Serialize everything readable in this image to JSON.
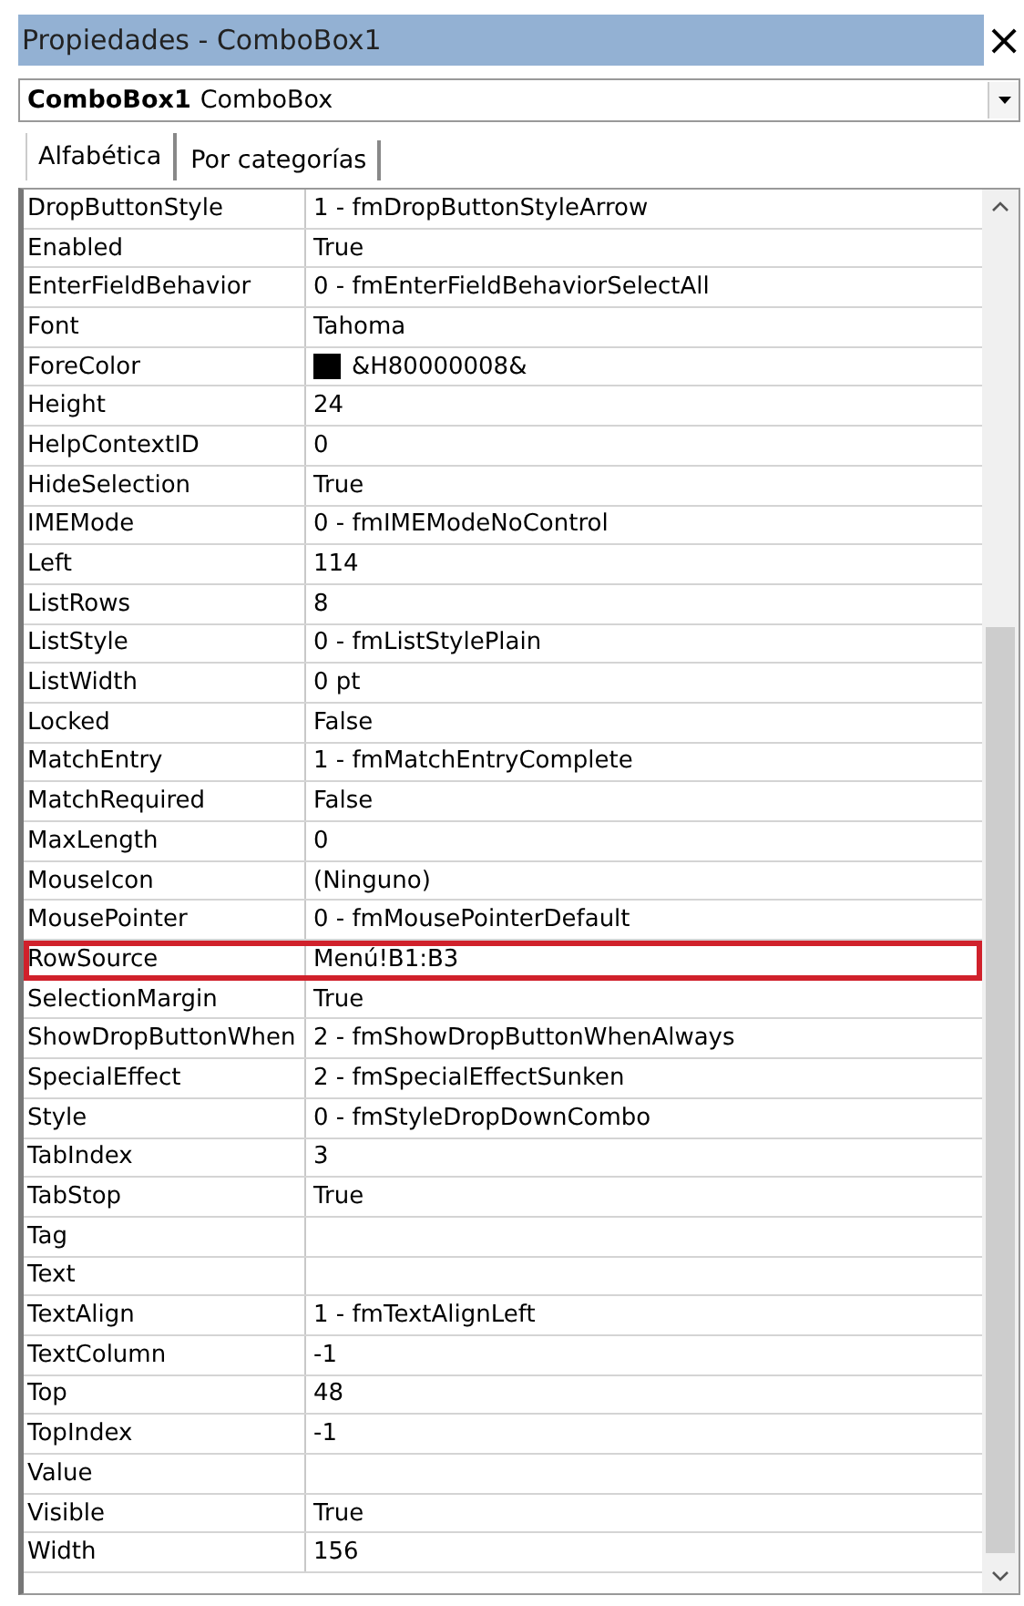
{
  "window": {
    "title": "Propiedades - ComboBox1",
    "close": "×"
  },
  "object_selector": {
    "name": "ComboBox1",
    "type": "ComboBox"
  },
  "tabs": [
    {
      "label": "Alfabética",
      "selected": true
    },
    {
      "label": "Por categorías",
      "selected": false
    }
  ],
  "rows": [
    {
      "name": "DropButtonStyle",
      "value": "1 - fmDropButtonStyleArrow",
      "kind": "text",
      "highlighted": false
    },
    {
      "name": "Enabled",
      "value": "True",
      "kind": "text",
      "highlighted": false
    },
    {
      "name": "EnterFieldBehavior",
      "value": "0 - fmEnterFieldBehaviorSelectAll",
      "kind": "text",
      "highlighted": false
    },
    {
      "name": "Font",
      "value": "Tahoma",
      "kind": "text",
      "highlighted": false
    },
    {
      "name": "ForeColor",
      "value": "&H80000008&",
      "kind": "color",
      "color": "#000000",
      "highlighted": false
    },
    {
      "name": "Height",
      "value": "24",
      "kind": "text",
      "highlighted": false
    },
    {
      "name": "HelpContextID",
      "value": "0",
      "kind": "text",
      "highlighted": false
    },
    {
      "name": "HideSelection",
      "value": "True",
      "kind": "text",
      "highlighted": false
    },
    {
      "name": "IMEMode",
      "value": "0 - fmIMEModeNoControl",
      "kind": "text",
      "highlighted": false
    },
    {
      "name": "Left",
      "value": "114",
      "kind": "text",
      "highlighted": false
    },
    {
      "name": "ListRows",
      "value": "8",
      "kind": "text",
      "highlighted": false
    },
    {
      "name": "ListStyle",
      "value": "0 - fmListStylePlain",
      "kind": "text",
      "highlighted": false
    },
    {
      "name": "ListWidth",
      "value": "0 pt",
      "kind": "text",
      "highlighted": false
    },
    {
      "name": "Locked",
      "value": "False",
      "kind": "text",
      "highlighted": false
    },
    {
      "name": "MatchEntry",
      "value": "1 - fmMatchEntryComplete",
      "kind": "text",
      "highlighted": false
    },
    {
      "name": "MatchRequired",
      "value": "False",
      "kind": "text",
      "highlighted": false
    },
    {
      "name": "MaxLength",
      "value": "0",
      "kind": "text",
      "highlighted": false
    },
    {
      "name": "MouseIcon",
      "value": "(Ninguno)",
      "kind": "text",
      "highlighted": false
    },
    {
      "name": "MousePointer",
      "value": "0 - fmMousePointerDefault",
      "kind": "text",
      "highlighted": false
    },
    {
      "name": "RowSource",
      "value": "Menú!B1:B3",
      "kind": "text",
      "highlighted": true
    },
    {
      "name": "SelectionMargin",
      "value": "True",
      "kind": "text",
      "highlighted": false
    },
    {
      "name": "ShowDropButtonWhen",
      "value": "2 - fmShowDropButtonWhenAlways",
      "kind": "text",
      "highlighted": false
    },
    {
      "name": "SpecialEffect",
      "value": "2 - fmSpecialEffectSunken",
      "kind": "text",
      "highlighted": false
    },
    {
      "name": "Style",
      "value": "0 - fmStyleDropDownCombo",
      "kind": "text",
      "highlighted": false
    },
    {
      "name": "TabIndex",
      "value": "3",
      "kind": "text",
      "highlighted": false
    },
    {
      "name": "TabStop",
      "value": "True",
      "kind": "text",
      "highlighted": false
    },
    {
      "name": "Tag",
      "kind": "text",
      "highlighted": false
    },
    {
      "name": "Text",
      "kind": "text",
      "highlighted": false
    },
    {
      "name": "TextAlign",
      "value": "1 - fmTextAlignLeft",
      "kind": "text",
      "highlighted": false
    },
    {
      "name": "TextColumn",
      "value": "-1",
      "kind": "text",
      "highlighted": false
    },
    {
      "name": "Top",
      "value": "48",
      "kind": "text",
      "highlighted": false
    },
    {
      "name": "TopIndex",
      "value": "-1",
      "kind": "text",
      "highlighted": false
    },
    {
      "name": "Value",
      "kind": "text",
      "highlighted": false
    },
    {
      "name": "Visible",
      "value": "True",
      "kind": "text",
      "highlighted": false
    },
    {
      "name": "Width",
      "value": "156",
      "kind": "text",
      "highlighted": false
    }
  ]
}
